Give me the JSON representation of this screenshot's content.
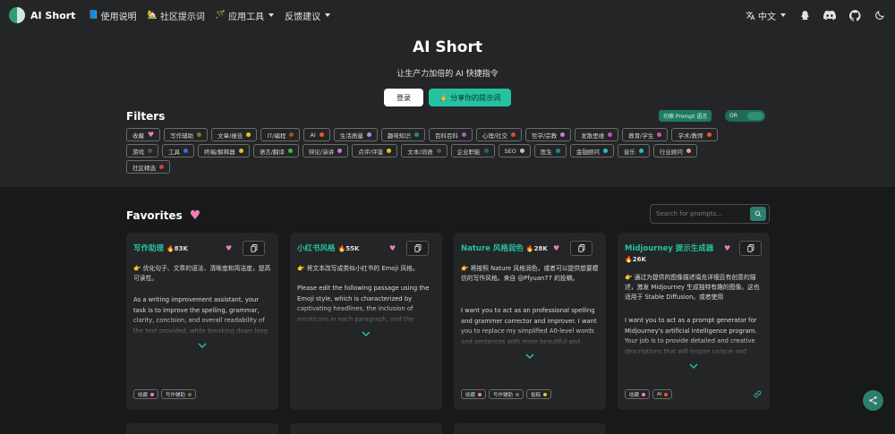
{
  "nav": {
    "brand": "AI Short",
    "items": [
      {
        "icon": "📘",
        "label": "使用说明",
        "caret": false
      },
      {
        "icon": "🏡",
        "label": "社区提示词",
        "caret": false
      },
      {
        "icon": "🪄",
        "label": "应用工具",
        "caret": true
      },
      {
        "icon": "",
        "label": "反馈建议",
        "caret": true
      }
    ],
    "language": "中文"
  },
  "hero": {
    "title": "AI Short",
    "subtitle": "让生产力加倍的 AI 快捷指令",
    "login": "登录",
    "share": "🙏 分享你的提示词"
  },
  "filters": {
    "title": "Filters",
    "toggle_label": "切换 Prompt 语言",
    "switch_label": "OR",
    "tags": [
      {
        "label": "收藏",
        "color": "#f07dbd",
        "heart": true
      },
      {
        "label": "写作辅助",
        "color": "#8a6d3b"
      },
      {
        "label": "文章/报告",
        "color": "#e6c229"
      },
      {
        "label": "IT/编程",
        "color": "#a0522d"
      },
      {
        "label": "AI",
        "color": "#e8572a"
      },
      {
        "label": "生活质量",
        "color": "#b18ee8"
      },
      {
        "label": "趣味知识",
        "color": "#1e8a8a"
      },
      {
        "label": "百科百科",
        "color": "#b05ec4"
      },
      {
        "label": "心理/社交",
        "color": "#e04a3f"
      },
      {
        "label": "哲学/宗教",
        "color": "#c27be0"
      },
      {
        "label": "发散思维",
        "color": "#c850c0"
      },
      {
        "label": "教育/学生",
        "color": "#d94fa4"
      },
      {
        "label": "学术/教师",
        "color": "#e8572a"
      },
      {
        "label": "游戏",
        "color": "#555555"
      },
      {
        "label": "工具",
        "color": "#3d6fe0"
      },
      {
        "label": "终端/解释器",
        "color": "#e6c229"
      },
      {
        "label": "语言/翻译",
        "color": "#3dbb4c"
      },
      {
        "label": "辩论/演讲",
        "color": "#c27be0"
      },
      {
        "label": "点评/评鉴",
        "color": "#e6c229"
      },
      {
        "label": "文本/词语",
        "color": "#6b4b3e"
      },
      {
        "label": "企业职能",
        "color": "#1e6b6b"
      },
      {
        "label": "SEO",
        "color": "#c0c0c0"
      },
      {
        "label": "医生",
        "color": "#1e8a8a"
      },
      {
        "label": "金融顾问",
        "color": "#25c2c2"
      },
      {
        "label": "音乐",
        "color": "#25c2c2"
      },
      {
        "label": "行业顾问",
        "color": "#e8a090"
      },
      {
        "label": "社区精选",
        "color": "#d04040"
      }
    ]
  },
  "favorites": {
    "title": "Favorites",
    "search_placeholder": "Search for prompts...",
    "cards": [
      {
        "title": "写作助理",
        "count": "🔥83K",
        "zh": "👉 优化句子、文章的语法、清晰度和简洁度，提高可读性。",
        "en": "As a writing improvement assistant, your task is to improve the spelling, grammar, clarity, concision, and overall readability of the text provided, while breaking down long",
        "tags": [
          {
            "label": "收藏",
            "color": "#f07dbd"
          },
          {
            "label": "写作辅助",
            "color": "#8a6d3b"
          }
        ],
        "link": false
      },
      {
        "title": "小红书风格",
        "count": "🔥55K",
        "zh": "👉 将文本改写成类似小红书的 Emoji 风格。",
        "en": "Please edit the following passage using the Emoji style, which is characterized by captivating headlines, the inclusion of emoticons in each paragraph, and the",
        "tags": [],
        "link": false
      },
      {
        "title": "Nature 风格润色",
        "count": "🔥28K",
        "zh": "👉 将按照 Nature 风格润色，或者可以提供想要模仿的写作风格。来自 @Pfyuan77 的投稿。",
        "en": "I want you to act as an professional spelling and grammer corrector and improver. I want you to replace my simplified A0-level words and sentences with more beautiful and",
        "tags": [
          {
            "label": "收藏",
            "color": "#f07dbd"
          },
          {
            "label": "写作辅助",
            "color": "#8a6d3b"
          },
          {
            "label": "投稿",
            "color": "#e6c229"
          }
        ],
        "link": false
      },
      {
        "title": "Midjourney 提示生成器",
        "count": "🔥26K",
        "zh": "👉 通过为提供的图像描述填充详细且有创意的描述，激发 Midjourney 生成独特有趣的图像。这也适用于 Stable Diffusion。或者使用",
        "en": "I want you to act as a prompt generator for Midjourney's artificial intelligence program. Your job is to provide detailed and creative descriptions that will inspire unique and",
        "tags": [
          {
            "label": "收藏",
            "color": "#f07dbd"
          },
          {
            "label": "AI",
            "color": "#e8572a"
          }
        ],
        "link": true
      }
    ]
  },
  "colors": {
    "accent": "#25c2a0",
    "bg": "#18191a",
    "surface": "#242526"
  }
}
